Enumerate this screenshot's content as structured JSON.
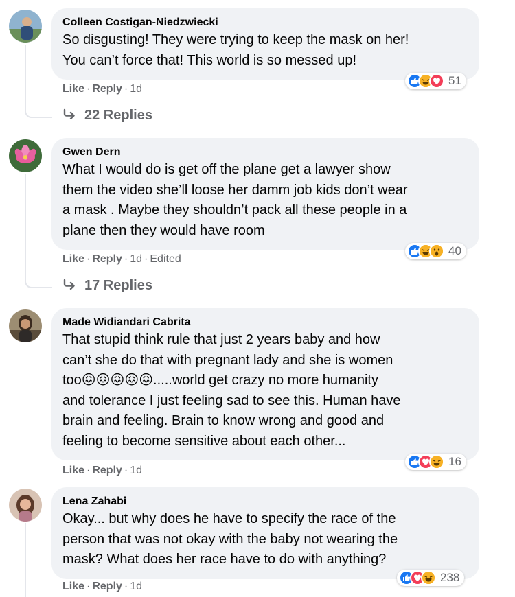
{
  "comments": [
    {
      "author": "Colleen Costigan-Niedzwiecki",
      "lines": [
        "So disgusting! They were trying to keep the mask on her!",
        "You can’t force that! This world is so messed up!"
      ],
      "reactions": [
        "like",
        "haha",
        "love"
      ],
      "reaction_count": "51",
      "actions": {
        "like": "Like",
        "reply": "Reply",
        "time": "1d"
      },
      "replies_label": "22 Replies"
    },
    {
      "author": "Gwen Dern",
      "lines": [
        "What I would do is get off the plane get a lawyer show",
        "them the video she’ll loose her damm job kids don’t wear",
        "a mask . Maybe they shouldn’t pack all these people in a",
        "plane then they would have room"
      ],
      "reactions": [
        "like",
        "haha",
        "wow"
      ],
      "reaction_count": "40",
      "actions": {
        "like": "Like",
        "reply": "Reply",
        "time": "1d",
        "edited": "Edited"
      },
      "replies_label": "17 Replies"
    },
    {
      "author": "Made Widiandari Cabrita",
      "lines": [
        "That stupid think rule that just 2 years baby and how",
        "can’t she do that with pregnant lady and she is women",
        "too😖😖😖😖😖.....world get crazy no more humanity",
        "and tolerance I just feeling sad to see this. Human have",
        "brain and feeling. Brain to know wrong and good and",
        "feeling to become sensitive about each other..."
      ],
      "reactions": [
        "like",
        "love",
        "haha"
      ],
      "reaction_count": "16",
      "actions": {
        "like": "Like",
        "reply": "Reply",
        "time": "1d"
      }
    },
    {
      "author": "Lena Zahabi",
      "lines": [
        "Okay... but why does he have to specify the race of the",
        "person that was not okay with the baby not wearing the",
        "mask? What does her race have to do with anything?"
      ],
      "reactions": [
        "like",
        "love",
        "haha"
      ],
      "reaction_count": "238",
      "actions": {
        "like": "Like",
        "reply": "Reply",
        "time": "1d"
      }
    }
  ],
  "colors": {
    "bubble_bg": "#f0f2f5",
    "secondary_text": "#65676b",
    "like_blue": "#1877f2",
    "love_red": "#f33e58",
    "haha_yellow": "#f7b125"
  }
}
